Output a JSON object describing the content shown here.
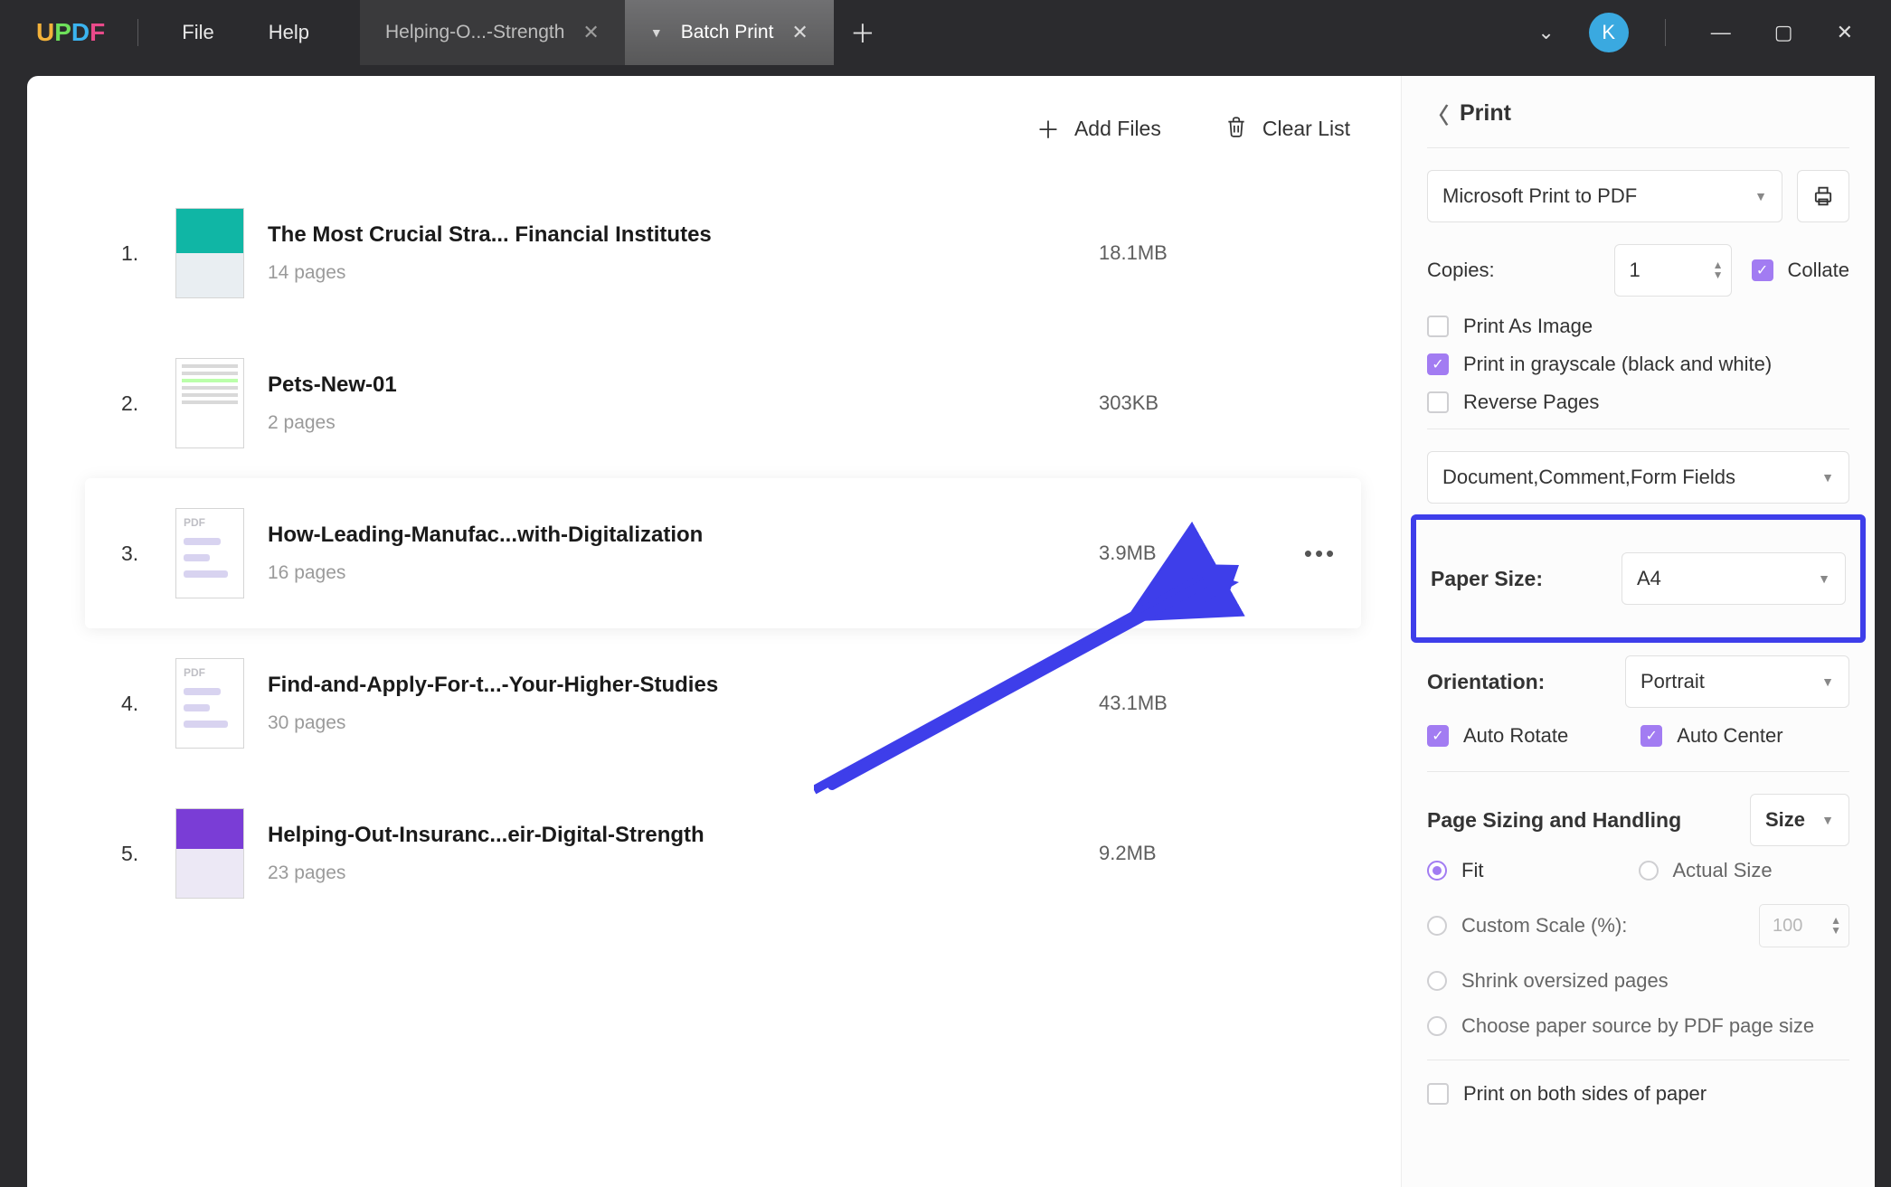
{
  "app": {
    "logo": "UPDF",
    "avatar": "K"
  },
  "menu": {
    "file": "File",
    "help": "Help"
  },
  "tabs": {
    "inactive": "Helping-O...-Strength",
    "active": "Batch Print"
  },
  "actions": {
    "add": "Add Files",
    "clear": "Clear List"
  },
  "files": [
    {
      "n": "1.",
      "title": "The Most Crucial Stra... Financial Institutes",
      "pages": "14 pages",
      "size": "18.1MB",
      "thumb": "teal"
    },
    {
      "n": "2.",
      "title": "Pets-New-01",
      "pages": "2 pages",
      "size": "303KB",
      "thumb": "doc"
    },
    {
      "n": "3.",
      "title": "How-Leading-Manufac...with-Digitalization",
      "pages": "16 pages",
      "size": "3.9MB",
      "thumb": "pdf"
    },
    {
      "n": "4.",
      "title": "Find-and-Apply-For-t...-Your-Higher-Studies",
      "pages": "30 pages",
      "size": "43.1MB",
      "thumb": "pdf"
    },
    {
      "n": "5.",
      "title": "Helping-Out-Insuranc...eir-Digital-Strength",
      "pages": "23 pages",
      "size": "9.2MB",
      "thumb": "purple"
    }
  ],
  "panel": {
    "title": "Print",
    "printer": "Microsoft Print to PDF",
    "copies_label": "Copies:",
    "copies_value": "1",
    "collate": "Collate",
    "print_image": "Print As Image",
    "grayscale": "Print in grayscale (black and white)",
    "reverse": "Reverse Pages",
    "content_select": "Document,Comment,Form Fields",
    "paper_label": "Paper Size:",
    "paper_value": "A4",
    "orient_label": "Orientation:",
    "orient_value": "Portrait",
    "auto_rotate": "Auto Rotate",
    "auto_center": "Auto Center",
    "sizing_header": "Page Sizing and Handling",
    "sizing_mode": "Size",
    "fit": "Fit",
    "actual": "Actual Size",
    "custom": "Custom Scale (%):",
    "custom_value": "100",
    "shrink": "Shrink oversized pages",
    "choose_src": "Choose paper source by PDF page size",
    "both_sides": "Print on both sides of paper"
  }
}
